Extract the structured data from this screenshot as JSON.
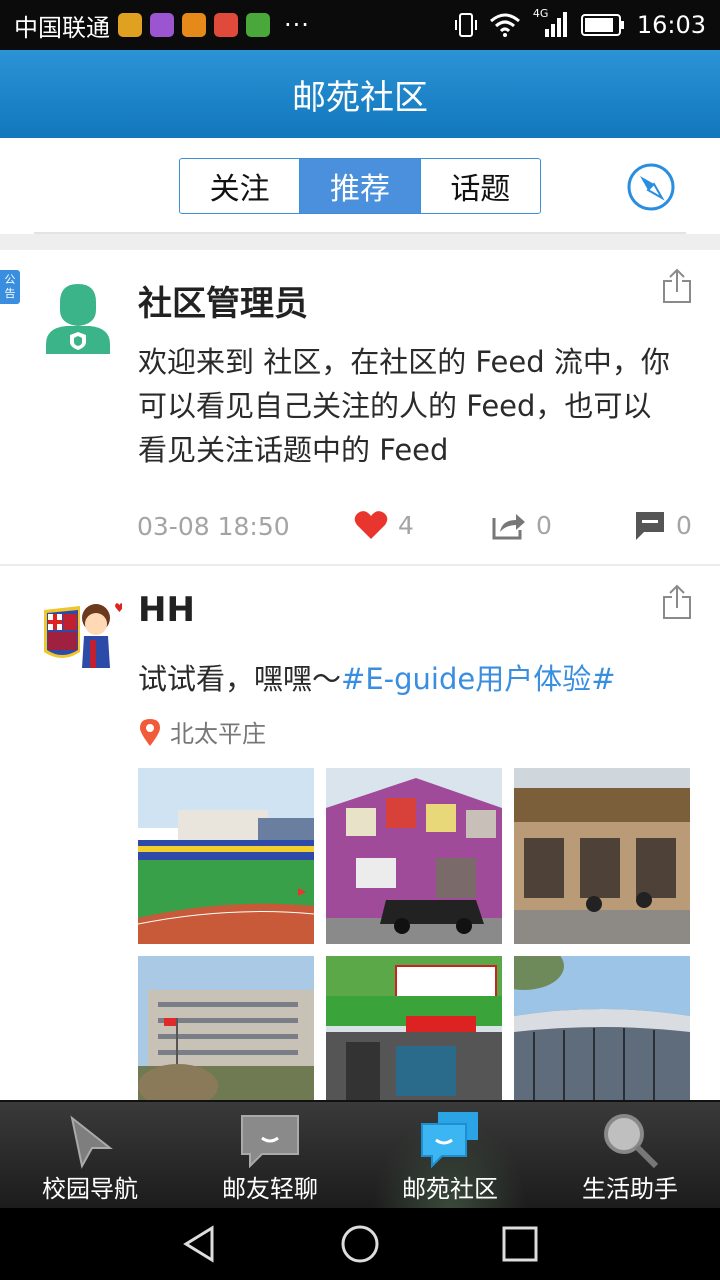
{
  "status_bar": {
    "carrier": "中国联通",
    "dots": "···",
    "network": "4G",
    "time": "16:03"
  },
  "header": {
    "title": "邮苑社区"
  },
  "tabs": [
    {
      "label": "关注",
      "active": false
    },
    {
      "label": "推荐",
      "active": true
    },
    {
      "label": "话题",
      "active": false
    }
  ],
  "posts": [
    {
      "tag": "公告",
      "author": "社区管理员",
      "content": "欢迎来到 社区，在社区的 Feed 流中，你可以看见自己关注的人的 Feed，也可以看见关注话题中的 Feed",
      "time": "03-08 18:50",
      "likes": "4",
      "forwards": "0",
      "comments": "0"
    },
    {
      "author": "HH",
      "content": "试试看，嘿嘿～",
      "topic": "#E-guide用户体验#",
      "location": "北太平庄",
      "photos": [
        "stadium-photo",
        "building-photo",
        "canteen-photo",
        "office-building-photo",
        "bookstore-photo",
        "gym-photo"
      ]
    }
  ],
  "bottom_nav": [
    {
      "label": "校园导航",
      "icon": "navigation-arrow-icon",
      "active": false
    },
    {
      "label": "邮友轻聊",
      "icon": "chat-bubble-icon",
      "active": false
    },
    {
      "label": "邮苑社区",
      "icon": "community-chat-icon",
      "active": true
    },
    {
      "label": "生活助手",
      "icon": "magnifier-icon",
      "active": false
    }
  ],
  "colors": {
    "header": "#1a84cb",
    "accent": "#4a90dc",
    "like": "#e8352e",
    "location": "#f25b3a",
    "topic": "#3a8ee0"
  }
}
